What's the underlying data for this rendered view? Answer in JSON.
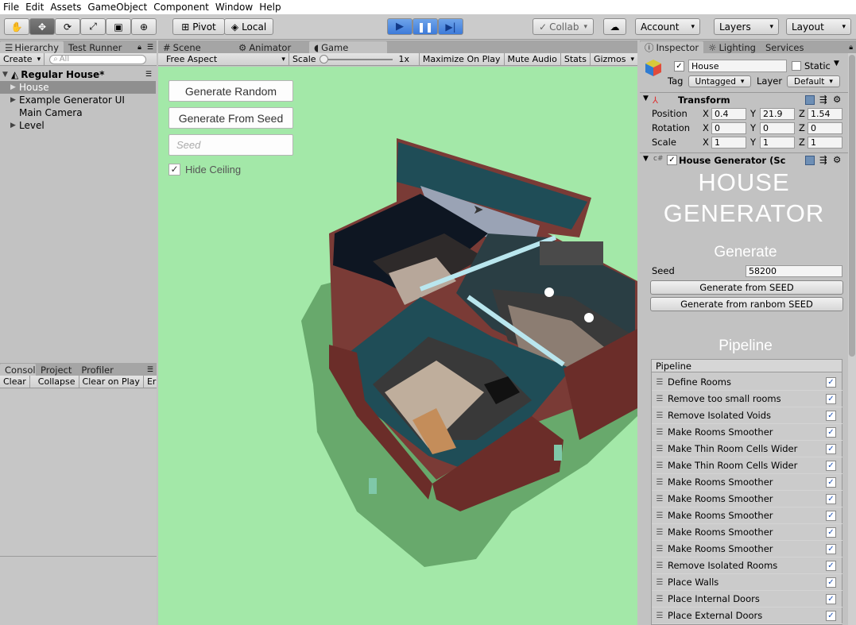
{
  "menu": [
    "File",
    "Edit",
    "Assets",
    "GameObject",
    "Component",
    "Window",
    "Help"
  ],
  "toolbar": {
    "pivot": "Pivot",
    "local": "Local",
    "collab": "Collab",
    "account": "Account",
    "layers": "Layers",
    "layout": "Layout"
  },
  "hierarchy": {
    "tabs": [
      "Hierarchy",
      "Test Runner"
    ],
    "create": "Create",
    "search_placeholder": "All",
    "scene": "Regular House*",
    "items": [
      "House",
      "Example Generator UI",
      "Main Camera",
      "Level"
    ]
  },
  "console": {
    "tabs": [
      "Console",
      "Project",
      "Profiler"
    ],
    "buttons": [
      "Clear",
      "Collapse",
      "Clear on Play",
      "Error Pause"
    ]
  },
  "game": {
    "tabs": [
      "Scene",
      "Animator",
      "Game"
    ],
    "aspect": "Free Aspect",
    "scale_label": "Scale",
    "scale_value": "1x",
    "options": [
      "Maximize On Play",
      "Mute Audio",
      "Stats",
      "Gizmos"
    ],
    "buttons": {
      "random": "Generate Random",
      "seed": "Generate From Seed"
    },
    "seed_placeholder": "Seed",
    "hide_ceiling": "Hide Ceiling",
    "hide_ceiling_checked": true
  },
  "inspector": {
    "tabs": [
      "Inspector",
      "Lighting",
      "Services"
    ],
    "object_name": "House",
    "static_label": "Static",
    "tag_label": "Tag",
    "tag_value": "Untagged",
    "layer_label": "Layer",
    "layer_value": "Default",
    "transform": {
      "title": "Transform",
      "rows": [
        {
          "label": "Position",
          "x": "0.4",
          "y": "21.9",
          "z": "1.54"
        },
        {
          "label": "Rotation",
          "x": "0",
          "y": "0",
          "z": "0"
        },
        {
          "label": "Scale",
          "x": "1",
          "y": "1",
          "z": "1"
        }
      ]
    },
    "component_title": "House Generator (Sc",
    "banner_line1": "HOUSE",
    "banner_line2": "GENERATOR",
    "generate_heading": "Generate",
    "seed_label": "Seed",
    "seed_value": "58200",
    "btn_seed": "Generate from SEED",
    "btn_random": "Generate from ranbom SEED",
    "pipeline_heading": "Pipeline",
    "pipeline_list_header": "Pipeline",
    "pipeline": [
      "Define Rooms",
      "Remove too small rooms",
      "Remove Isolated Voids",
      "Make Rooms Smoother",
      "Make Thin Room Cells Wider",
      "Make Thin Room Cells Wider",
      "Make Rooms Smoother",
      "Make Rooms Smoother",
      "Make Rooms Smoother",
      "Make Rooms Smoother",
      "Make Rooms Smoother",
      "Remove Isolated Rooms",
      "Place Walls",
      "Place Internal Doors",
      "Place External Doors"
    ]
  },
  "colors": {
    "game_bg": "#a3e8a8",
    "accent": "#3d7ad9",
    "wall_outer": "#5b2a27",
    "wall_inner": "#1f4d57"
  }
}
